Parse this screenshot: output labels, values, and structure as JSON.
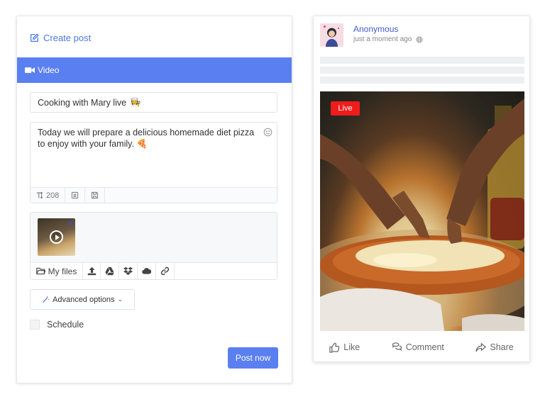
{
  "composer": {
    "header": "Create post",
    "tab": "Video",
    "title_value": "Cooking with Mary live",
    "title_emoji": "👩‍🍳",
    "description_value": "Today we will prepare a delicious homemade diet pizza to enjoy with your family. 🍕",
    "char_count": "208",
    "media_toolbar": {
      "my_files_label": "My files"
    },
    "advanced_label": "Advanced options",
    "schedule_label": "Schedule",
    "post_button_label": "Post now"
  },
  "preview": {
    "user_name": "Anonymous",
    "time_text": "just a moment ago",
    "live_label": "Live",
    "actions": {
      "like": "Like",
      "comment": "Comment",
      "share": "Share"
    }
  },
  "colors": {
    "accent": "#5a7ff0",
    "link": "#4a78e8",
    "live": "#ee1c1c"
  }
}
